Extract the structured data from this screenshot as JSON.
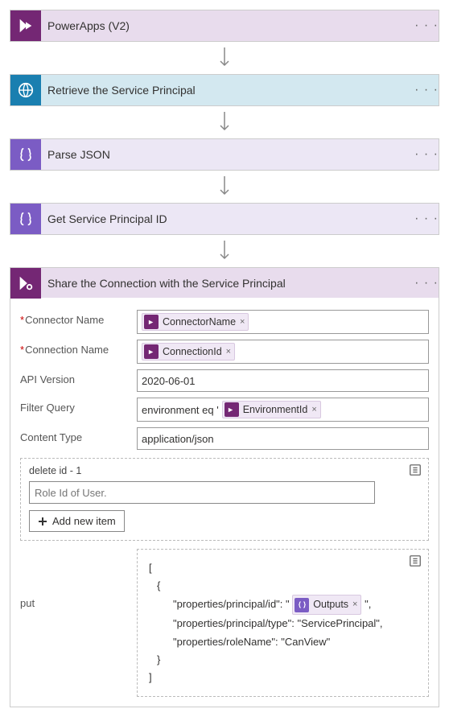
{
  "steps": {
    "s1": {
      "title": "PowerApps (V2)"
    },
    "s2": {
      "title": "Retrieve the Service Principal"
    },
    "s3": {
      "title": "Parse JSON"
    },
    "s4": {
      "title": "Get Service Principal ID"
    },
    "s5": {
      "title": "Share the Connection with the Service Principal"
    }
  },
  "fields": {
    "connectorName": {
      "label": "Connector Name",
      "token": "ConnectorName"
    },
    "connectionName": {
      "label": "Connection Name",
      "token": "ConnectionId"
    },
    "apiVersion": {
      "label": "API Version",
      "value": "2020-06-01"
    },
    "filterQuery": {
      "label": "Filter Query",
      "prefix": "environment eq '",
      "token": "EnvironmentId"
    },
    "contentType": {
      "label": "Content Type",
      "value": "application/json"
    }
  },
  "deleteBox": {
    "label": "delete id - 1",
    "placeholder": "Role Id of User.",
    "addBtn": "Add new item"
  },
  "putBox": {
    "label": "put",
    "l1": "[",
    "l2": "{",
    "l3a": "\"properties/principal/id\": \"",
    "l3token": "Outputs",
    "l3b": "\",",
    "l4": "\"properties/principal/type\": \"ServicePrincipal\",",
    "l5": "\"properties/roleName\": \"CanView\"",
    "l6": "}",
    "l7": "]"
  },
  "ellipsis": "· · ·",
  "x": "×"
}
